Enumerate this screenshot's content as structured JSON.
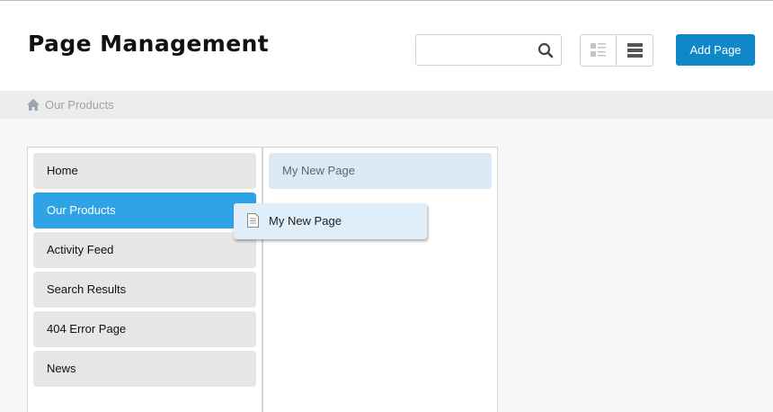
{
  "header": {
    "title": "Page Management",
    "search": {
      "value": "",
      "placeholder": ""
    },
    "view_toggle": {
      "options": [
        "grid-list-icon",
        "list-icon"
      ],
      "selected": "list-icon"
    },
    "add_button_label": "Add Page"
  },
  "breadcrumb": {
    "icon": "home-icon",
    "items": [
      "Our Products"
    ]
  },
  "sidebar": {
    "items": [
      {
        "label": "Home",
        "active": false
      },
      {
        "label": "Our Products",
        "active": true
      },
      {
        "label": "Activity Feed",
        "active": false
      },
      {
        "label": "Search Results",
        "active": false
      },
      {
        "label": "404 Error Page",
        "active": false
      },
      {
        "label": "News",
        "active": false
      }
    ]
  },
  "children": {
    "items": [
      {
        "label": "My New Page"
      }
    ]
  },
  "drag": {
    "label": "My New Page",
    "icon": "document-icon"
  },
  "colors": {
    "accent": "#0f87c9",
    "active_item": "#2fa3e6",
    "item_bg": "#e6e6e6",
    "child_bg": "#dbe9f7",
    "breadcrumb_bg": "#ececec"
  }
}
